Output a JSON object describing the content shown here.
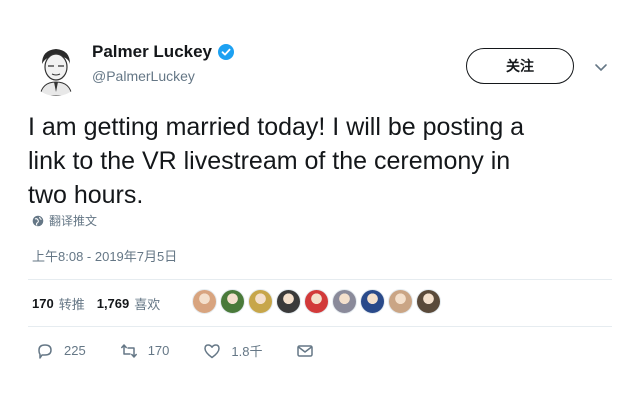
{
  "user": {
    "display_name": "Palmer Luckey",
    "handle": "@PalmerLuckey"
  },
  "follow_button": {
    "label": "关注"
  },
  "tweet": {
    "text_lines": [
      "I am getting married today! I will be posting a",
      "link to the VR livestream of the ceremony in",
      "two hours."
    ],
    "translate_label": "翻译推文",
    "timestamp": "上午8:08 - 2019年7月5日"
  },
  "stats": {
    "retweets_count": "170",
    "retweets_label": "转推",
    "likes_count": "1,769",
    "likes_label": "喜欢"
  },
  "liked_by_avatars": [
    "#d8a47f",
    "#4a7a3a",
    "#c7a64a",
    "#3a3a3a",
    "#d23a3a",
    "#8a8a9a",
    "#2a4a8a",
    "#caa585",
    "#5a4a3a"
  ],
  "actions": {
    "reply_count": "225",
    "retweet_count": "170",
    "like_count": "1.8千"
  },
  "colors": {
    "verified": "#1da1f2",
    "text": "#14171a",
    "secondary": "#657786"
  }
}
